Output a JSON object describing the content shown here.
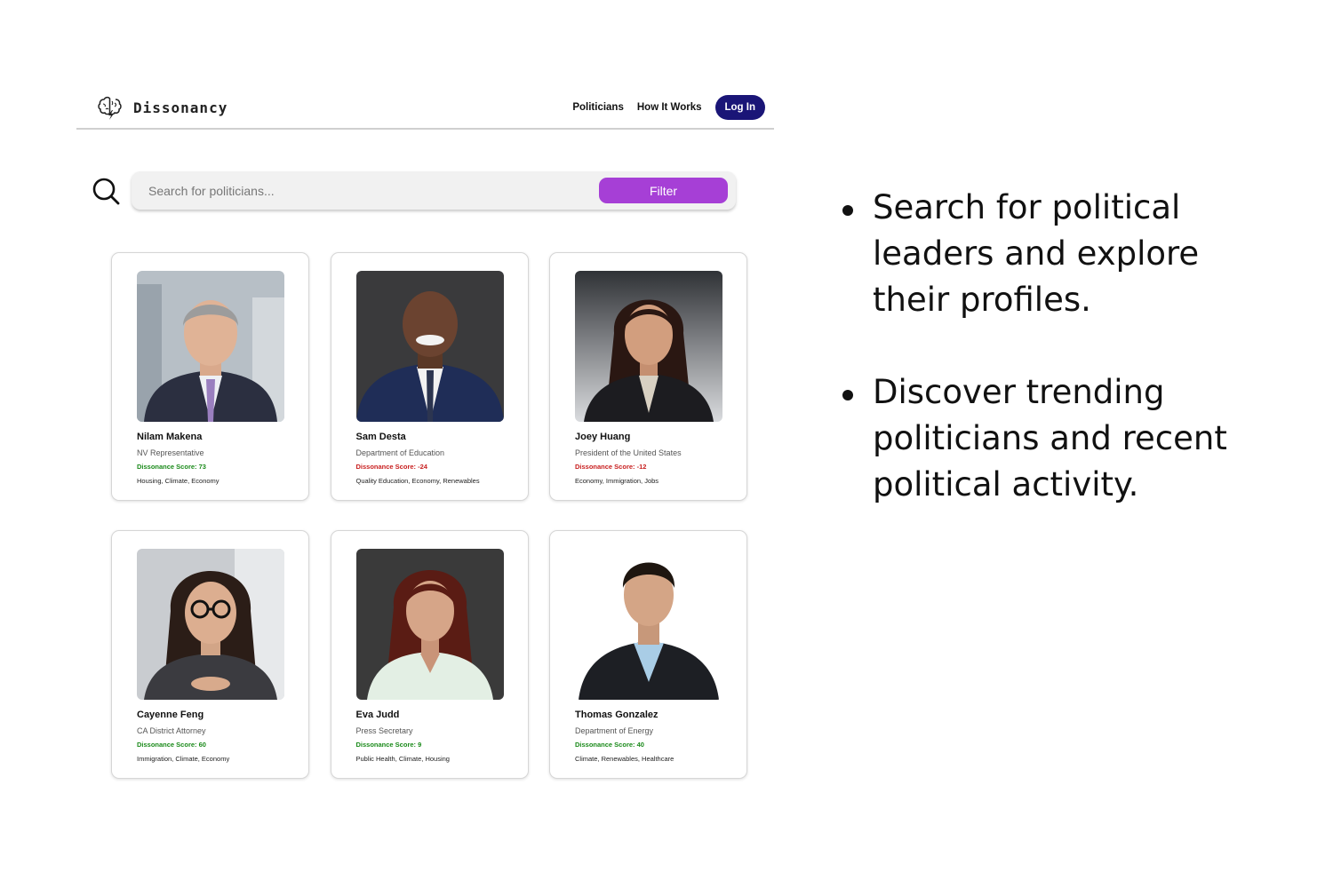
{
  "app": {
    "name": "Dissonancy",
    "logo_icon": "brain-lightning-icon"
  },
  "nav": {
    "politicians": "Politicians",
    "how_it_works": "How It Works",
    "login": "Log In",
    "login_color": "#1a1577"
  },
  "search": {
    "icon": "search-icon",
    "placeholder": "Search for politicians...",
    "filter_label": "Filter",
    "filter_color": "#a63fd6"
  },
  "colors": {
    "score_positive": "#1a8a1a",
    "score_negative": "#c81e1e"
  },
  "politicians": [
    {
      "name": "Nilam Makena",
      "role": "NV Representative",
      "score": "Dissonance Score: 73",
      "score_status": "positive",
      "topics": "Housing, Climate, Economy"
    },
    {
      "name": "Sam Desta",
      "role": "Department of Education",
      "score": "Dissonance Score: -24",
      "score_status": "negative",
      "topics": "Quality Education, Economy, Renewables"
    },
    {
      "name": "Joey Huang",
      "role": "President of the United States",
      "score": "Dissonance Score: -12",
      "score_status": "negative",
      "topics": "Economy, Immigration, Jobs"
    },
    {
      "name": "Cayenne Feng",
      "role": "CA District Attorney",
      "score": "Dissonance Score: 60",
      "score_status": "positive",
      "topics": "Immigration, Climate, Economy"
    },
    {
      "name": "Eva Judd",
      "role": "Press Secretary",
      "score": "Dissonance Score: 9",
      "score_status": "positive",
      "topics": "Public Health, Climate, Housing"
    },
    {
      "name": "Thomas Gonzalez",
      "role": "Department of Energy",
      "score": "Dissonance Score: 40",
      "score_status": "positive",
      "topics": "Climate, Renewables, Healthcare"
    }
  ],
  "bullets": [
    "Search for political leaders and explore their profiles.",
    "Discover trending politicians and recent political activity."
  ]
}
